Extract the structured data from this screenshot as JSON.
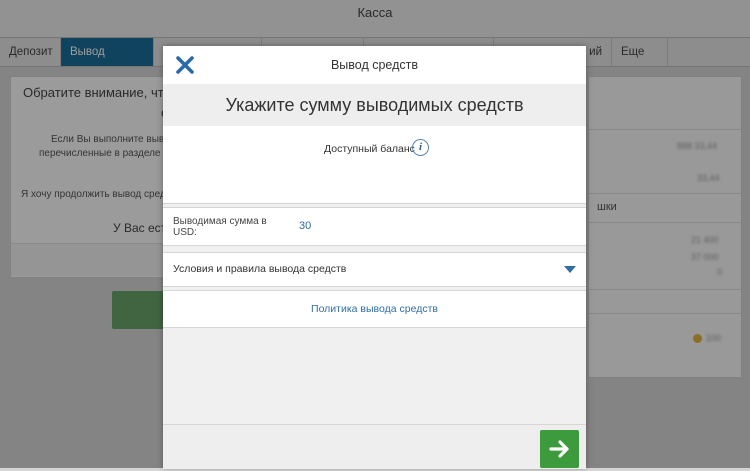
{
  "app": {
    "title": "Касса"
  },
  "tabs": [
    {
      "label": "Депозит"
    },
    {
      "label": "Вывод средств"
    },
    {
      "label": ""
    },
    {
      "label": ""
    },
    {
      "label": ""
    },
    {
      "label": "ий"
    },
    {
      "label": "Еще ▼"
    }
  ],
  "background": {
    "notice_title": "Обратите внимание, что",
    "notice_title_cont": "о",
    "notice_text_1": "Если Вы выполните выв",
    "notice_text_2": "перечисленные в разделе \"С",
    "continue_text": "Я хочу продолжить вывод сред",
    "you_have": "У Вас ест",
    "right_word": "шки",
    "right_values": [
      "888 33,44",
      "33,44",
      "21 400",
      "37 000",
      "0",
      "100"
    ]
  },
  "modal": {
    "title": "Вывод средств",
    "heading": "Укажите сумму выводимых средств",
    "balance_label": "Доступный баланс",
    "info_icon_glyph": "i",
    "amount_label": "Выводимая сумма в USD:",
    "amount_value": "30",
    "terms_label": "Условия и правила вывода средств",
    "policy_link": "Политика вывода средств"
  },
  "colors": {
    "accent": "#1a6d96",
    "link": "#2f6fa6",
    "next_button": "#3d9a3d"
  },
  "icons": {
    "close": "close-icon",
    "info": "info-icon",
    "chevron": "chevron-down-icon",
    "next": "arrow-right-icon"
  }
}
